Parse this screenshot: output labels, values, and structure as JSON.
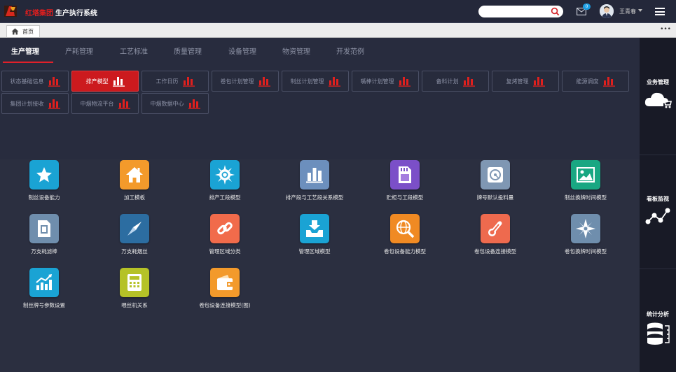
{
  "header": {
    "company": "红塔集团",
    "system_name": "生产执行系统",
    "search_placeholder": "",
    "mail_count": "0",
    "username": "王青春"
  },
  "tabs": [
    {
      "label": "首页"
    }
  ],
  "module_tabs": [
    "生产管理",
    "产耗管理",
    "工艺标准",
    "质量管理",
    "设备管理",
    "物资管理",
    "开发范例"
  ],
  "active_module": "生产管理",
  "sub_buttons": [
    {
      "label": "状态基础信息",
      "active": false
    },
    {
      "label": "排产模型",
      "active": true
    },
    {
      "label": "工作日历",
      "active": false
    },
    {
      "label": "卷包计划管理",
      "active": false
    },
    {
      "label": "制丝计划管理",
      "active": false
    },
    {
      "label": "嘴棒计划管理",
      "active": false
    },
    {
      "label": "备料计划",
      "active": false
    },
    {
      "label": "复烤管理",
      "active": false
    },
    {
      "label": "能源调度",
      "active": false
    },
    {
      "label": "集团计划接收",
      "active": false
    },
    {
      "label": "中烟物流平台",
      "active": false
    },
    {
      "label": "中烟数据中心",
      "active": false
    }
  ],
  "modules": [
    {
      "label": "制丝设备能力",
      "icon": "star-icon",
      "color": "#1aa3d4"
    },
    {
      "label": "加工模板",
      "icon": "home-icon",
      "color": "#f39a2b"
    },
    {
      "label": "排产工段模型",
      "icon": "gear-burst-icon",
      "color": "#1aa3d4"
    },
    {
      "label": "排产段与工艺段关系模型",
      "icon": "bar-chart-icon",
      "color": "#6c8fbd"
    },
    {
      "label": "贮柜与工段模型",
      "icon": "sd-card-icon",
      "color": "#7b4fc8"
    },
    {
      "label": "牌号默认投料量",
      "icon": "disk-icon",
      "color": "#7f97b3"
    },
    {
      "label": "制丝换牌时间模型",
      "icon": "image-icon",
      "color": "#19a782"
    },
    {
      "label": "万支耗滤棒",
      "icon": "sim-card-icon",
      "color": "#6f8ead"
    },
    {
      "label": "万支耗烟丝",
      "icon": "compass-icon",
      "color": "#2c6da1"
    },
    {
      "label": "管理区域分类",
      "icon": "link-icon",
      "color": "#f16b4b"
    },
    {
      "label": "管理区域模型",
      "icon": "inbox-download-icon",
      "color": "#1aa3d4"
    },
    {
      "label": "卷包设备能力模型",
      "icon": "globe-search-icon",
      "color": "#f08a23"
    },
    {
      "label": "卷包设备连接模型",
      "icon": "thermometer-icon",
      "color": "#ee6a4e"
    },
    {
      "label": "卷包换牌时间模型",
      "icon": "compass-rose-icon",
      "color": "#6f8ead"
    },
    {
      "label": "制丝牌号参数设置",
      "icon": "rising-chart-icon",
      "color": "#1aa3d4"
    },
    {
      "label": "喂丝机关系",
      "icon": "calculator-icon",
      "color": "#b5c227"
    },
    {
      "label": "卷包设备连接模型(图)",
      "icon": "wallet-icon",
      "color": "#f39a2b"
    }
  ],
  "sidebar": [
    {
      "label": "业务管理",
      "icon": "cloud-cart-icon"
    },
    {
      "label": "看板监视",
      "icon": "network-icon"
    },
    {
      "label": "统计分析",
      "icon": "database-icon"
    }
  ]
}
